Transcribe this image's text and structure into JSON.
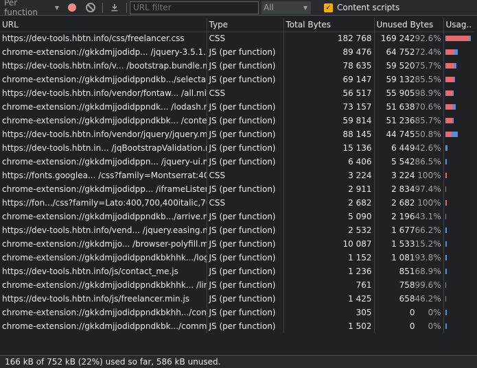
{
  "toolbar": {
    "mode_label": "Per function",
    "filter_placeholder": "URL filter",
    "type_filter": "All",
    "content_scripts_label": "Content scripts",
    "content_scripts_checked": true
  },
  "columns": {
    "url": "URL",
    "type": "Type",
    "total": "Total Bytes",
    "unused": "Unused Bytes",
    "usage": "Usag.."
  },
  "rows": [
    {
      "url": "https://dev-tools.hbtn.info/css/freelancer.css",
      "type": "CSS",
      "total": "182 768",
      "unused": "169 242",
      "pct": "92.6%",
      "unused_frac": 0.926
    },
    {
      "url": "chrome-extension://gkkdmjjodidp... /jquery-3.5.1.min.js",
      "type": "JS (per function)",
      "total": "89 476",
      "unused": "64 752",
      "pct": "72.4%",
      "unused_frac": 0.724
    },
    {
      "url": "https://dev-tools.hbtn.info/v... /bootstrap.bundle.min.js",
      "type": "JS (per function)",
      "total": "78 635",
      "unused": "59 520",
      "pct": "75.7%",
      "unused_frac": 0.757
    },
    {
      "url": "chrome-extension://gkkdmjjodidppndkb.../selectable.js",
      "type": "JS (per function)",
      "total": "69 147",
      "unused": "59 132",
      "pct": "85.5%",
      "unused_frac": 0.855
    },
    {
      "url": "https://dev-tools.hbtn.info/vendor/fontaw... /all.min.css",
      "type": "CSS",
      "total": "56 517",
      "unused": "55 905",
      "pct": "98.9%",
      "unused_frac": 0.989
    },
    {
      "url": "chrome-extension://gkkdmjjodidppndk... /lodash.min.js",
      "type": "JS (per function)",
      "total": "73 157",
      "unused": "51 638",
      "pct": "70.6%",
      "unused_frac": 0.706
    },
    {
      "url": "chrome-extension://gkkdmjjodidppndkbk... /content.js",
      "type": "JS (per function)",
      "total": "59 814",
      "unused": "51 236",
      "pct": "85.7%",
      "unused_frac": 0.857
    },
    {
      "url": "https://dev-tools.hbtn.info/vendor/jquery/jquery.min.js",
      "type": "JS (per function)",
      "total": "88 145",
      "unused": "44 745",
      "pct": "50.8%",
      "unused_frac": 0.508
    },
    {
      "url": "https://dev-tools.hbtn.in... /jqBootstrapValidation.min.js",
      "type": "JS (per function)",
      "total": "15 136",
      "unused": "6 449",
      "pct": "42.6%",
      "unused_frac": 0.426
    },
    {
      "url": "chrome-extension://gkkdmjjodidppn... /jquery-ui.min.js",
      "type": "JS (per function)",
      "total": "6 406",
      "unused": "5 542",
      "pct": "86.5%",
      "unused_frac": 0.865
    },
    {
      "url": "https://fonts.googlea... /css?family=Montserrat:400,700",
      "type": "CSS",
      "total": "3 224",
      "unused": "3 224",
      "pct": "100%",
      "unused_frac": 1.0
    },
    {
      "url": "chrome-extension://gkkdmjjodidpp... /iframeListener.js",
      "type": "JS (per function)",
      "total": "2 911",
      "unused": "2 834",
      "pct": "97.4%",
      "unused_frac": 0.974
    },
    {
      "url": "https://fon.../css?family=Lato:400,700,400italic,700italic",
      "type": "CSS",
      "total": "2 682",
      "unused": "2 682",
      "pct": "100%",
      "unused_frac": 1.0
    },
    {
      "url": "chrome-extension://gkkdmjjodidppndkb.../arrive.min.js",
      "type": "JS (per function)",
      "total": "5 090",
      "unused": "2 196",
      "pct": "43.1%",
      "unused_frac": 0.431
    },
    {
      "url": "https://dev-tools.hbtn.info/vend... /jquery.easing.min.js",
      "type": "JS (per function)",
      "total": "2 532",
      "unused": "1 677",
      "pct": "66.2%",
      "unused_frac": 0.662
    },
    {
      "url": "chrome-extension://gkkdmjjo... /browser-polyfill.min.js",
      "type": "JS (per function)",
      "total": "10 087",
      "unused": "1 533",
      "pct": "15.2%",
      "unused_frac": 0.152
    },
    {
      "url": "chrome-extension://gkkdmjjodidppndkbkhhk.../login.js",
      "type": "JS (per function)",
      "total": "1 152",
      "unused": "1 081",
      "pct": "93.8%",
      "unused_frac": 0.938
    },
    {
      "url": "https://dev-tools.hbtn.info/js/contact_me.js",
      "type": "JS (per function)",
      "total": "1 236",
      "unused": "851",
      "pct": "68.9%",
      "unused_frac": 0.689
    },
    {
      "url": "chrome-extension://gkkdmjjodidppndkbkhhk... /limit.js",
      "type": "JS (per function)",
      "total": "761",
      "unused": "758",
      "pct": "99.6%",
      "unused_frac": 0.996
    },
    {
      "url": "https://dev-tools.hbtn.info/js/freelancer.min.js",
      "type": "JS (per function)",
      "total": "1 425",
      "unused": "658",
      "pct": "46.2%",
      "unused_frac": 0.462
    },
    {
      "url": "chrome-extension://gkkdmjjodidppndkbkhh.../config.js",
      "type": "JS (per function)",
      "total": "305",
      "unused": "0",
      "pct": "0%",
      "unused_frac": 0.0
    },
    {
      "url": "chrome-extension://gkkdmjjodidppndkbk.../common.js",
      "type": "JS (per function)",
      "total": "1 502",
      "unused": "0",
      "pct": "0%",
      "unused_frac": 0.0
    }
  ],
  "max_total": 182768,
  "footer": "166 kB of 752 kB (22%) used so far, 586 kB unused.",
  "colors": {
    "unused": "#e46a6f",
    "used": "#5b8bd6",
    "accent": "#f9ab00"
  }
}
